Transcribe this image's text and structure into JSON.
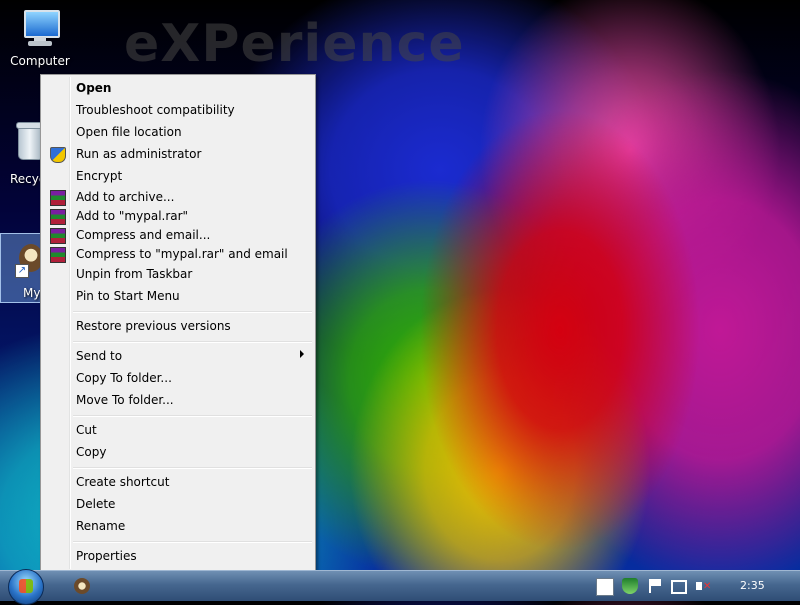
{
  "wallpaper": {
    "watermark": "eXPerience"
  },
  "desktop": {
    "computer_label": "Computer",
    "recycle_label": "Recyc",
    "mypal_label": "My"
  },
  "context_menu": {
    "items": [
      {
        "label": "Open",
        "bold": true
      },
      {
        "label": "Troubleshoot compatibility"
      },
      {
        "label": "Open file location"
      },
      {
        "label": "Run as administrator",
        "icon": "shield-icon"
      },
      {
        "label": "Encrypt"
      },
      {
        "label": "Add to archive...",
        "icon": "winrar-icon"
      },
      {
        "label": "Add to \"mypal.rar\"",
        "icon": "winrar-icon"
      },
      {
        "label": "Compress and email...",
        "icon": "winrar-icon"
      },
      {
        "label": "Compress to \"mypal.rar\" and email",
        "icon": "winrar-icon"
      },
      {
        "label": "Unpin from Taskbar"
      },
      {
        "label": "Pin to Start Menu"
      },
      {
        "label": "Restore previous versions"
      },
      {
        "label": "Send to",
        "submenu": true
      },
      {
        "label": "Copy To folder..."
      },
      {
        "label": "Move To folder..."
      },
      {
        "label": "Cut"
      },
      {
        "label": "Copy"
      },
      {
        "label": "Create shortcut"
      },
      {
        "label": "Delete"
      },
      {
        "label": "Rename"
      },
      {
        "label": "Properties"
      }
    ]
  },
  "taskbar": {
    "clock": "2:35"
  }
}
